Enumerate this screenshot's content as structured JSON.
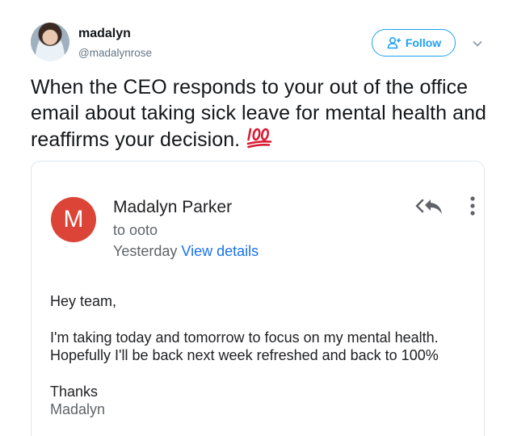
{
  "tweet": {
    "author_name": "madalyn",
    "author_handle": "@madalynrose",
    "follow_label": "Follow",
    "text": "When the CEO responds to your out of the office email about taking sick leave for mental health and reaffirms your decision.",
    "emoji": "hundred-points-emoji"
  },
  "email": {
    "sender_initial": "M",
    "sender_name": "Madalyn Parker",
    "recipient": "to ooto",
    "date": "Yesterday",
    "view_details": "View details",
    "greeting": "Hey team,",
    "body_line_1": "I'm taking today and tomorrow to focus on my mental health.",
    "body_line_2": "Hopefully I'll be back next week refreshed and back to 100%",
    "signoff": "Thanks",
    "signoff_name": "Madalyn"
  },
  "colors": {
    "accent": "#1da1f2",
    "avatar_red": "#db4437",
    "link_blue": "#1a73e8",
    "emoji_red": "#d91c35"
  },
  "icons": [
    "follow-user-icon",
    "chevron-down-icon",
    "reply-all-icon",
    "more-vert-icon",
    "hundred-points-emoji"
  ]
}
